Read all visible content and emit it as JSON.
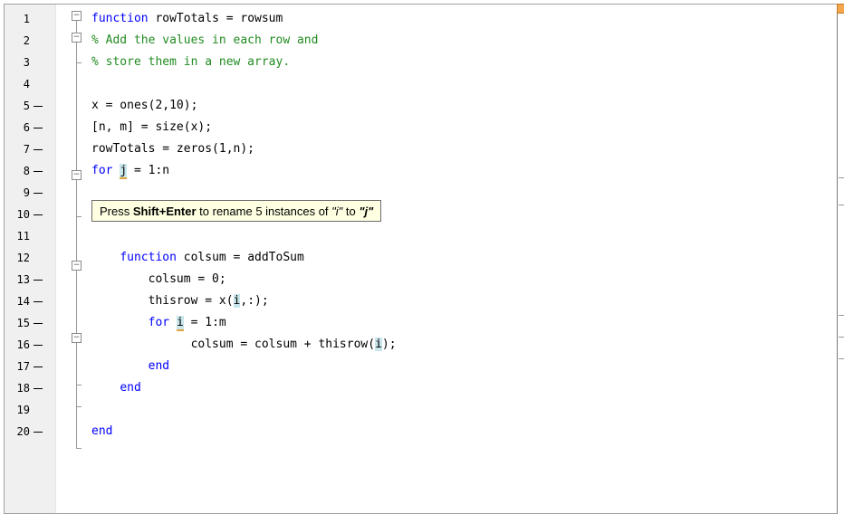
{
  "editor": {
    "lines": [
      {
        "num": "1",
        "dash": false,
        "parts": [
          {
            "t": "function",
            "c": "kw"
          },
          {
            "t": " rowTotals = rowsum",
            "c": ""
          }
        ]
      },
      {
        "num": "2",
        "dash": false,
        "parts": [
          {
            "t": "% Add the values in each row and",
            "c": "cm"
          }
        ]
      },
      {
        "num": "3",
        "dash": false,
        "parts": [
          {
            "t": "% store them in a new array.",
            "c": "cm"
          }
        ]
      },
      {
        "num": "4",
        "dash": false,
        "parts": []
      },
      {
        "num": "5",
        "dash": true,
        "parts": [
          {
            "t": "x = ones(2,10);",
            "c": ""
          }
        ]
      },
      {
        "num": "6",
        "dash": true,
        "parts": [
          {
            "t": "[n, m] = size(x);",
            "c": ""
          }
        ]
      },
      {
        "num": "7",
        "dash": true,
        "parts": [
          {
            "t": "rowTotals = zeros(1,n);",
            "c": ""
          }
        ]
      },
      {
        "num": "8",
        "dash": true,
        "parts": [
          {
            "t": "for",
            "c": "kw"
          },
          {
            "t": " ",
            "c": ""
          },
          {
            "t": "j",
            "c": "hlu"
          },
          {
            "t": " = 1:n",
            "c": ""
          }
        ]
      },
      {
        "num": "9",
        "dash": true,
        "parts": []
      },
      {
        "num": "10",
        "dash": true,
        "parts": [
          {
            "t": "end",
            "c": "kw"
          }
        ]
      },
      {
        "num": "11",
        "dash": false,
        "parts": []
      },
      {
        "num": "12",
        "dash": false,
        "parts": [
          {
            "t": "    ",
            "c": ""
          },
          {
            "t": "function",
            "c": "kw"
          },
          {
            "t": " colsum = addToSum",
            "c": ""
          }
        ]
      },
      {
        "num": "13",
        "dash": true,
        "parts": [
          {
            "t": "        colsum = 0;",
            "c": ""
          }
        ]
      },
      {
        "num": "14",
        "dash": true,
        "parts": [
          {
            "t": "        thisrow = x(",
            "c": ""
          },
          {
            "t": "i",
            "c": "hl"
          },
          {
            "t": ",:);",
            "c": ""
          }
        ]
      },
      {
        "num": "15",
        "dash": true,
        "parts": [
          {
            "t": "        ",
            "c": ""
          },
          {
            "t": "for",
            "c": "kw"
          },
          {
            "t": " ",
            "c": ""
          },
          {
            "t": "i",
            "c": "hlu"
          },
          {
            "t": " = 1:m",
            "c": ""
          }
        ]
      },
      {
        "num": "16",
        "dash": true,
        "parts": [
          {
            "t": "              colsum = colsum + thisrow(",
            "c": ""
          },
          {
            "t": "i",
            "c": "hl"
          },
          {
            "t": ");",
            "c": ""
          }
        ]
      },
      {
        "num": "17",
        "dash": true,
        "parts": [
          {
            "t": "        ",
            "c": ""
          },
          {
            "t": "end",
            "c": "kw"
          }
        ]
      },
      {
        "num": "18",
        "dash": true,
        "parts": [
          {
            "t": "    ",
            "c": ""
          },
          {
            "t": "end",
            "c": "kw"
          }
        ]
      },
      {
        "num": "19",
        "dash": false,
        "parts": []
      },
      {
        "num": "20",
        "dash": true,
        "parts": [
          {
            "t": "end",
            "c": "kw"
          }
        ]
      }
    ]
  },
  "tooltip": {
    "prefix": "Press ",
    "keys": "Shift+Enter",
    "middle": " to rename 5 instances of ",
    "old_name": "\"i\"",
    "to": " to ",
    "new_name": "\"j\""
  },
  "colors": {
    "keyword": "#0000ff",
    "comment": "#228b22",
    "highlight": "#c8e6ec",
    "tooltip_bg": "#ffffe1"
  }
}
